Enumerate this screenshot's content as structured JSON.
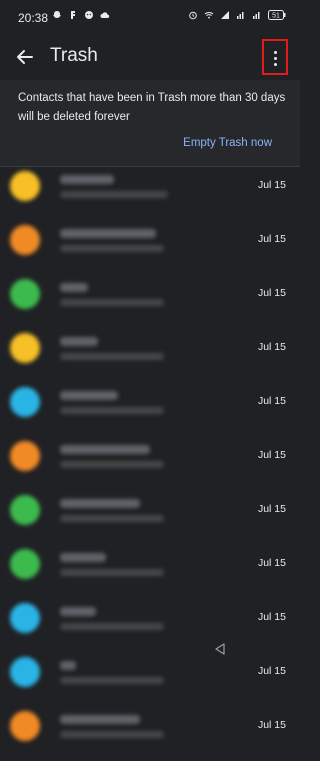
{
  "status_bar": {
    "time": "20:38",
    "left_icons": [
      "snapchat-icon",
      "hike-icon",
      "wechat-icon",
      "cloud-icon"
    ],
    "right_icons": [
      "alarm-icon",
      "wifi-icon",
      "volte-icon",
      "signal-icon",
      "signal-icon-2",
      "battery-icon"
    ],
    "battery": "51"
  },
  "app_bar": {
    "title": "Trash"
  },
  "notice": {
    "text": "Contacts that have been in Trash more than 30 days will be deleted forever",
    "empty_trash_label": "Empty Trash now"
  },
  "contacts": [
    {
      "color": "#f6c026",
      "date": "Jul 15"
    },
    {
      "color": "#f08a24",
      "date": "Jul 15"
    },
    {
      "color": "#3dba4e",
      "date": "Jul 15"
    },
    {
      "color": "#f6c026",
      "date": "Jul 15"
    },
    {
      "color": "#2ab4e6",
      "date": "Jul 15"
    },
    {
      "color": "#f08a24",
      "date": "Jul 15"
    },
    {
      "color": "#3dba4e",
      "date": "Jul 15"
    },
    {
      "color": "#3dba4e",
      "date": "Jul 15"
    },
    {
      "color": "#2ab4e6",
      "date": "Jul 15"
    },
    {
      "color": "#2ab4e6",
      "date": "Jul 15"
    },
    {
      "color": "#f08a24",
      "date": "Jul 15"
    }
  ],
  "colors": {
    "background": "#202124",
    "notice_background": "#27282b",
    "accent": "#8ab4f8",
    "highlight_box": "#e21b1b"
  }
}
